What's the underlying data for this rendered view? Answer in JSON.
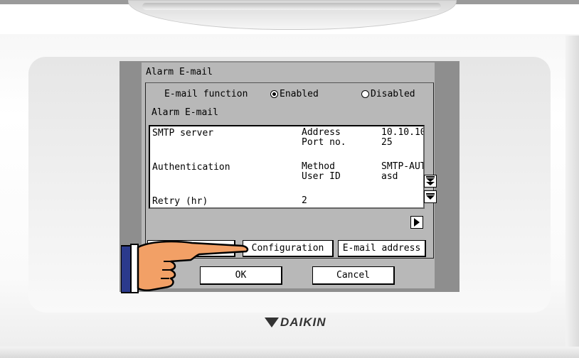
{
  "screen": {
    "title": "Alarm E-mail"
  },
  "email_function": {
    "label": "E-mail function",
    "enabled_label": "Enabled",
    "disabled_label": "Disabled",
    "selected": "Enabled"
  },
  "section_label": "Alarm E-mail",
  "list": {
    "rows": [
      {
        "name": "SMTP server",
        "keys": "Address\nPort no.",
        "values": "10.10.10\n25"
      },
      {
        "name": "Authentication",
        "keys": "Method\nUser ID",
        "values": "SMTP-AUT\nasd"
      },
      {
        "name": "Retry (hr)",
        "keys": "2",
        "values": ""
      }
    ]
  },
  "buttons": {
    "configuration": "Configuration",
    "email_address": "E-mail address",
    "ok": "OK",
    "cancel": "Cancel"
  },
  "icons": {
    "scroll_page_down": "double-down-arrow-icon",
    "scroll_down": "down-arrow-icon",
    "next_page": "right-arrow-icon",
    "pointer": "pointing-hand-icon"
  },
  "brand": {
    "name": "DAIKIN"
  },
  "colors": {
    "screen_bg": "#b8b8b8",
    "frame": "#8e8e8e"
  }
}
